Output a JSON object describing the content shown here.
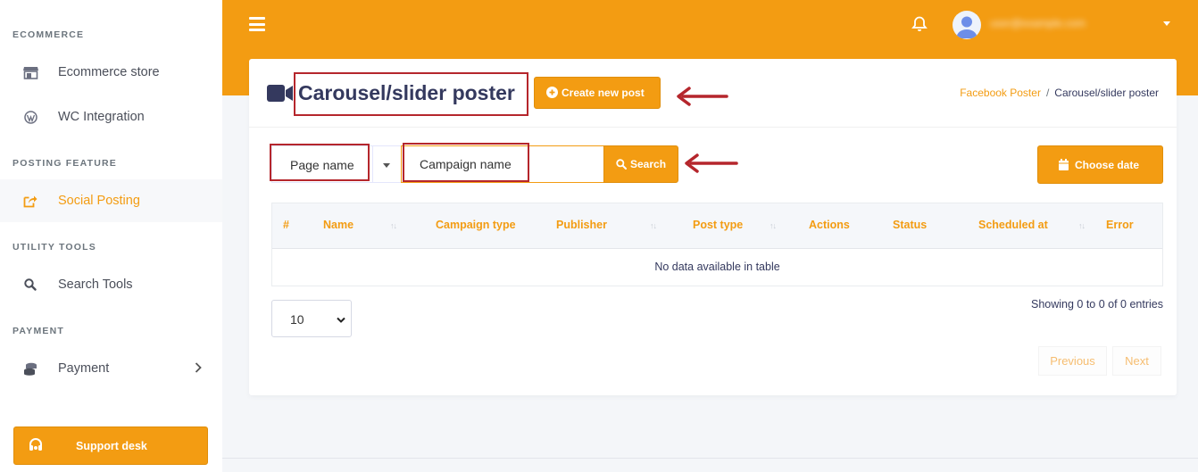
{
  "sidebar": {
    "sections": [
      "ECOMMERCE",
      "POSTING FEATURE",
      "UTILITY TOOLS",
      "PAYMENT"
    ],
    "items": [
      {
        "label": "Ecommerce store",
        "icon": "store-icon"
      },
      {
        "label": "WC Integration",
        "icon": "wordpress-icon"
      },
      {
        "label": "Social Posting",
        "icon": "share-icon",
        "active": true
      },
      {
        "label": "Search Tools",
        "icon": "search-icon"
      },
      {
        "label": "Payment",
        "icon": "coins-icon"
      }
    ],
    "support_label": "Support desk"
  },
  "header": {
    "username": "user@example.com"
  },
  "page": {
    "title": "Carousel/slider poster",
    "create_label": "Create new post",
    "breadcrumb": [
      "Facebook Poster",
      "Carousel/slider poster"
    ]
  },
  "filters": {
    "page_select": "Page name",
    "campaign_placeholder": "Campaign name",
    "search_label": "Search",
    "date_label": "Choose date"
  },
  "table": {
    "columns": [
      "#",
      "Name",
      "Campaign type",
      "Publisher",
      "Post type",
      "Actions",
      "Status",
      "Scheduled at",
      "Error"
    ],
    "empty_text": "No data available in table",
    "page_length": "10",
    "info": "Showing 0 to 0 of 0 entries",
    "prev_label": "Previous",
    "next_label": "Next"
  },
  "colors": {
    "accent": "#f39c12",
    "annotation": "#b5262c"
  }
}
